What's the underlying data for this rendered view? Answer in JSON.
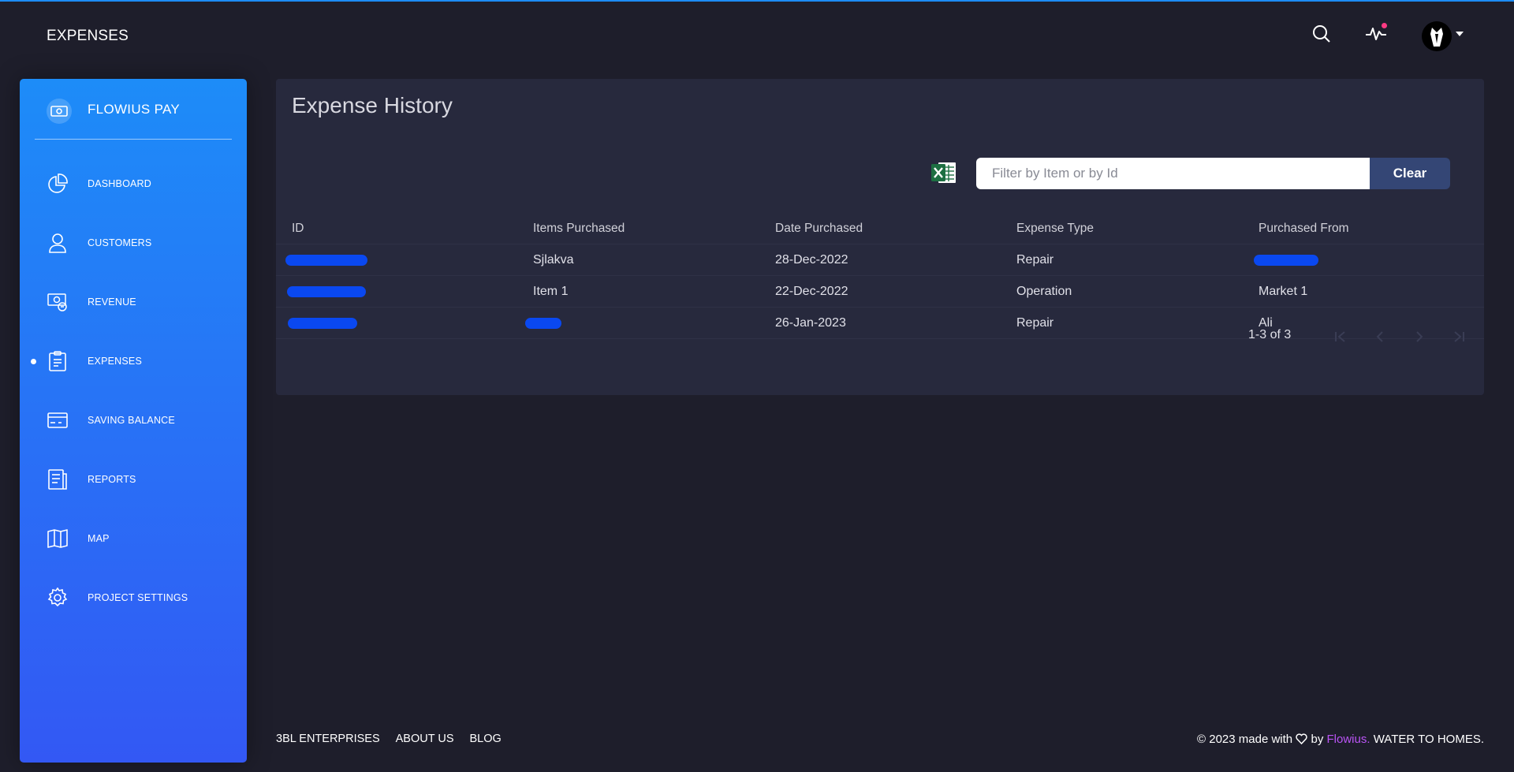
{
  "colors": {
    "accent": "#1d8cf8",
    "sidebar_end": "#3358f4",
    "background": "#1e1e2b",
    "card": "#27293d",
    "clear_button": "#344675",
    "footer_brand": "#ba54f5",
    "notification_dot": "#ff3a83",
    "redaction": "#0a48f0"
  },
  "navbar": {
    "title": "EXPENSES",
    "icons": [
      "search-icon",
      "activity-icon",
      "avatar",
      "chevron-down-icon"
    ]
  },
  "sidebar": {
    "brand": "FLOWIUS PAY",
    "brand_icon": "money-icon",
    "items": [
      {
        "label": "DASHBOARD",
        "icon": "pie-chart-icon",
        "active": false
      },
      {
        "label": "CUSTOMERS",
        "icon": "user-icon",
        "active": false
      },
      {
        "label": "REVENUE",
        "icon": "revenue-icon",
        "active": false
      },
      {
        "label": "EXPENSES",
        "icon": "clipboard-icon",
        "active": true
      },
      {
        "label": "SAVING BALANCE",
        "icon": "credit-card-icon",
        "active": false
      },
      {
        "label": "REPORTS",
        "icon": "receipt-icon",
        "active": false
      },
      {
        "label": "MAP",
        "icon": "map-icon",
        "active": false
      },
      {
        "label": "PROJECT SETTINGS",
        "icon": "gear-icon",
        "active": false
      }
    ]
  },
  "main": {
    "title": "Expense History",
    "export_icon": "excel-icon",
    "filter": {
      "placeholder": "Filter by Item or by Id",
      "value": ""
    },
    "clear_label": "Clear",
    "table": {
      "columns": [
        "ID",
        "Items Purchased",
        "Date Purchased",
        "Expense Type",
        "Purchased From"
      ],
      "rows": [
        {
          "id": "",
          "item": "Sjlakva",
          "date": "28-Dec-2022",
          "type": "Repair",
          "from": ""
        },
        {
          "id": "",
          "item": "Item 1",
          "date": "22-Dec-2022",
          "type": "Operation",
          "from": "Market 1"
        },
        {
          "id": "",
          "item": "",
          "date": "26-Jan-2023",
          "type": "Repair",
          "from": "Ali"
        }
      ]
    },
    "pagination": {
      "range": "1-3 of 3"
    }
  },
  "footer": {
    "links": [
      "3BL ENTERPRISES",
      "ABOUT US",
      "BLOG"
    ],
    "copyright_prefix": "© 2023 made with",
    "by": "by",
    "brand": "Flowius.",
    "suffix": "WATER TO HOMES."
  }
}
